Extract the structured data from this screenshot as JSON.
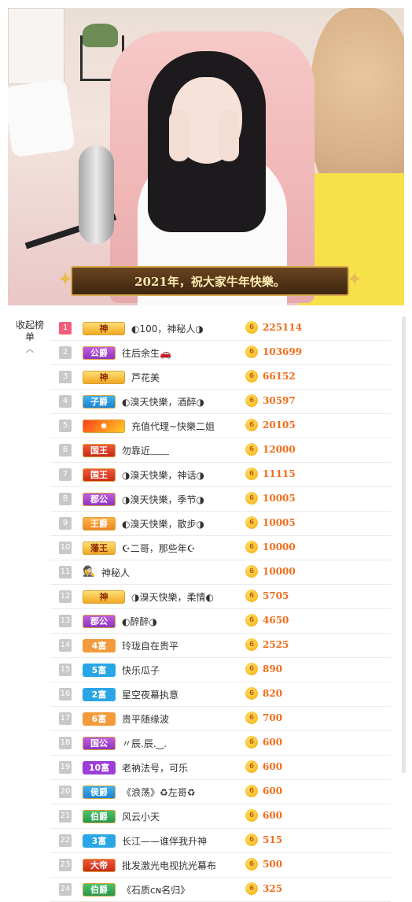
{
  "stream": {
    "banner_text": "2021年，祝大家牛年快樂。"
  },
  "sidebar": {
    "toggle_label": "收起榜单",
    "toggle_icon": "chevron-up-icon"
  },
  "colors": {
    "rank_top": "#f25e7a",
    "score": "#f06c19"
  },
  "ranking": [
    {
      "rank": "1",
      "badge": "神",
      "style": "gold wide",
      "name": "◐100，神秘人◑",
      "score": "225114"
    },
    {
      "rank": "2",
      "badge": "公爵",
      "style": "purple",
      "name": "往后余生🚗",
      "score": "103699"
    },
    {
      "rank": "3",
      "badge": "神",
      "style": "gold wide",
      "name": "芦花美",
      "score": "66152"
    },
    {
      "rank": "4",
      "badge": "子爵",
      "style": "blue",
      "name": "◐溴天快樂，酒醉◑",
      "score": "30597"
    },
    {
      "rank": "5",
      "badge": "",
      "style": "fire wide",
      "name": "充值代理~快樂二姐",
      "score": "20105"
    },
    {
      "rank": "6",
      "badge": "国王",
      "style": "red",
      "name": "勿靠近﹏﹏",
      "score": "12000"
    },
    {
      "rank": "7",
      "badge": "国王",
      "style": "red",
      "name": "◑溴天快樂，神话◑",
      "score": "11115"
    },
    {
      "rank": "8",
      "badge": "郡公",
      "style": "purple",
      "name": "◑溴天快樂，季节◑",
      "score": "10005"
    },
    {
      "rank": "9",
      "badge": "王爵",
      "style": "orange",
      "name": "◐溴天快樂，散步◑",
      "score": "10005"
    },
    {
      "rank": "10",
      "badge": "藩王",
      "style": "gold",
      "name": "☪二哥，那些年☪",
      "score": "10000"
    },
    {
      "rank": "11",
      "badge": "",
      "style": "mystery",
      "name": "神秘人",
      "score": "10000"
    },
    {
      "rank": "12",
      "badge": "神",
      "style": "gold wide",
      "name": "◑溴天快樂，柔情◐",
      "score": "5705"
    },
    {
      "rank": "13",
      "badge": "郡公",
      "style": "purple",
      "name": "◐醉醉◑",
      "score": "4650"
    },
    {
      "rank": "14",
      "badge": "4富",
      "style": "rich-orange",
      "name": "玲珑自在贵平",
      "score": "2525"
    },
    {
      "rank": "15",
      "badge": "5富",
      "style": "rich-blue",
      "name": "快乐瓜子",
      "score": "890"
    },
    {
      "rank": "16",
      "badge": "2富",
      "style": "rich-blue",
      "name": "星空夜幕执意",
      "score": "820"
    },
    {
      "rank": "17",
      "badge": "6富",
      "style": "rich-orange",
      "name": "贵平随缘波",
      "score": "700"
    },
    {
      "rank": "18",
      "badge": "国公",
      "style": "purple",
      "name": "〃辰.辰.‿.",
      "score": "600"
    },
    {
      "rank": "19",
      "badge": "10富",
      "style": "rich-purple",
      "name": "老衲法号，可乐",
      "score": "600"
    },
    {
      "rank": "20",
      "badge": "侯爵",
      "style": "blue",
      "name": "《浪荡》♻左哥♻",
      "score": "600"
    },
    {
      "rank": "21",
      "badge": "伯爵",
      "style": "green",
      "name": "风云小天",
      "score": "600"
    },
    {
      "rank": "22",
      "badge": "3富",
      "style": "rich-blue",
      "name": "长江——谁伴我升神",
      "score": "515"
    },
    {
      "rank": "23",
      "badge": "大帝",
      "style": "red",
      "name": "批发激光电视抗光幕布",
      "score": "500"
    },
    {
      "rank": "24",
      "badge": "伯爵",
      "style": "green",
      "name": "《石质ᴄɴ名归》",
      "score": "325"
    }
  ]
}
